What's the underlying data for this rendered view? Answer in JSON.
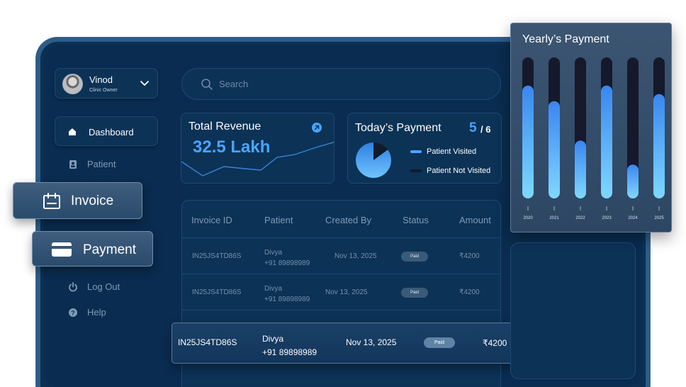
{
  "user": {
    "name": "Vinod",
    "role": "Clinic Owner"
  },
  "sidebar": {
    "items": [
      {
        "label": "Dashboard"
      },
      {
        "label": "Patient"
      },
      {
        "label": "Invoice"
      },
      {
        "label": "Payment"
      },
      {
        "label": "Log Out"
      },
      {
        "label": "Help"
      }
    ]
  },
  "search": {
    "placeholder": "Search"
  },
  "revenue": {
    "title": "Total Revenue",
    "value": "32.5 Lakh"
  },
  "today": {
    "title": "Today’s Payment",
    "count": "5",
    "total": "/ 6",
    "visited_fraction": 0.85,
    "legend": [
      {
        "label": "Patient Visited",
        "color": "#4aa4ff"
      },
      {
        "label": "Patient Not Visited",
        "color": "#111b2e"
      }
    ]
  },
  "table": {
    "columns": [
      "Invoice ID",
      "Patient",
      "Created By",
      "Status",
      "Amount"
    ],
    "rows": [
      {
        "id": "IN25JS4TD86S",
        "patient": "Divya",
        "phone": "+91 89898989",
        "date": "Nov 13, 2025",
        "status": "Paid",
        "amount": "₹4200"
      },
      {
        "id": "IN25JS4TD86S",
        "patient": "Divya",
        "phone": "+91 89898989",
        "date": "Nov 13, 2025",
        "status": "Paid",
        "amount": "₹4200"
      }
    ],
    "highlight": {
      "id": "IN25JS4TD86S",
      "patient": "Divya",
      "phone": "+91 89898989",
      "date": "Nov 13, 2025",
      "status": "Paid",
      "amount": "₹4200"
    }
  },
  "chart_data": {
    "type": "bar",
    "title": "Yearly’s Payment",
    "categories": [
      "2020",
      "2021",
      "2022",
      "2023",
      "2024",
      "2025"
    ],
    "values": [
      0.8,
      0.69,
      0.41,
      0.8,
      0.24,
      0.74
    ],
    "ylim": [
      0,
      1
    ],
    "grid": false,
    "colors": {
      "track": "#15192b",
      "bar_top": "#3a86f0",
      "bar_bottom": "#7fd8ff"
    }
  },
  "colors": {
    "accent": "#4aa4ff",
    "background": "#0b3054"
  }
}
